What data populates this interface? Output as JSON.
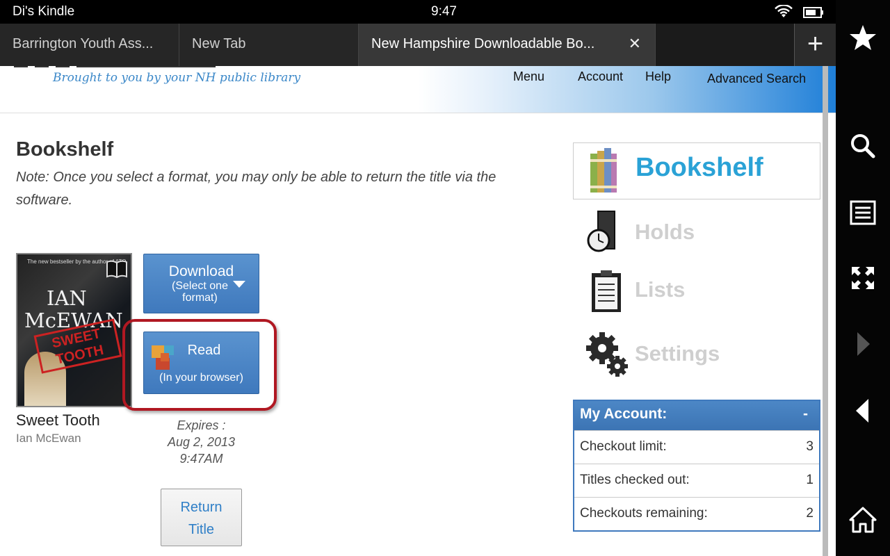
{
  "status_bar": {
    "device_name": "Di's Kindle",
    "time": "9:47"
  },
  "tabs": [
    {
      "label": "Barrington Youth Ass..."
    },
    {
      "label": "New Tab"
    },
    {
      "label": "New Hampshire Downloadable Bo...",
      "close": "✕"
    }
  ],
  "new_tab": "+",
  "header": {
    "tagline": "Brought to you by your NH public library",
    "links": {
      "menu": "Menu",
      "account": "Account",
      "help": "Help",
      "advanced_search": "Advanced Search"
    }
  },
  "page": {
    "title": "Bookshelf",
    "note": "Note: Once you select a format, you may only be able to return the title via the software."
  },
  "book": {
    "cover_blurb": "The new bestseller by the author of ATO",
    "cover_author_line1": "IAN",
    "cover_author_line2": "McEWAN",
    "cover_stamp": "SWEET TOOTH",
    "title": "Sweet Tooth",
    "author": "Ian McEwan",
    "expires_label": "Expires :",
    "expires_date": "Aug 2, 2013",
    "expires_time": "9:47AM"
  },
  "buttons": {
    "download": "Download",
    "download_sub": "(Select one format)",
    "read": "Read",
    "read_sub": "(In your browser)",
    "return_line1": "Return",
    "return_line2": "Title"
  },
  "side_nav": {
    "bookshelf": "Bookshelf",
    "holds": "Holds",
    "lists": "Lists",
    "settings": "Settings"
  },
  "account": {
    "heading": "My Account:",
    "toggle": "-",
    "rows": [
      {
        "label": "Checkout limit:",
        "value": "3"
      },
      {
        "label": "Titles checked out:",
        "value": "1"
      },
      {
        "label": "Checkouts remaining:",
        "value": "2"
      }
    ]
  },
  "colors": {
    "accent_blue": "#3f79bd",
    "bookshelf_cyan": "#2aa2d6",
    "highlight_red": "#b01822"
  },
  "icons": [
    "wifi-icon",
    "battery-icon",
    "star-icon",
    "search-icon",
    "menu-icon",
    "fullscreen-icon",
    "forward-icon",
    "back-icon",
    "home-icon"
  ]
}
